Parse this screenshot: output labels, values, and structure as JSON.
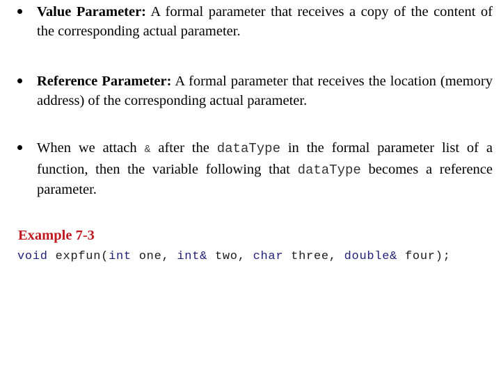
{
  "bullets": [
    {
      "term": "Value Parameter:",
      "text": " A formal parameter that receives a copy of the content of the corresponding actual parameter."
    },
    {
      "term": "Reference Parameter:",
      "text": " A formal parameter that receives the location (memory address) of the corresponding actual parameter."
    },
    {
      "parts": {
        "p1": "When we attach ",
        "amp": "&",
        "p2": " after the ",
        "code1": "dataType",
        "p3": " in the formal parameter list of a function, then the variable following that ",
        "code2": "dataType",
        "p4": " becomes a reference parameter."
      }
    }
  ],
  "example": {
    "title": "Example 7-3",
    "code_tokens": {
      "t1": "void",
      "t2": " expfun(",
      "t3": "int",
      "t4": " one, ",
      "t5": "int&",
      "t6": " two, ",
      "t7": "char",
      "t8": " three, ",
      "t9": "double&",
      "t10": " four);"
    }
  },
  "colors": {
    "example_title": "#c0181f",
    "keyword": "#1f1f7a"
  }
}
